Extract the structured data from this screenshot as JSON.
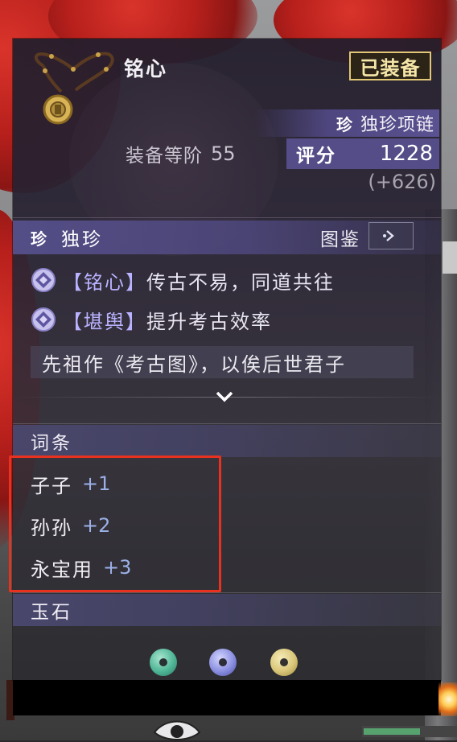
{
  "item": {
    "name": "铭心",
    "equipped_badge": "已装备",
    "rarity_glyph": "珍",
    "rarity_type": "独珍项链",
    "tier_label": "装备等阶",
    "tier_value": "55",
    "score_label": "评分",
    "score_value": "1228",
    "score_delta": "(+626)"
  },
  "rarity_section": {
    "glyph": "珍",
    "title": "独珍",
    "atlas_label": "图鉴",
    "atlas_icon": "arrow-right-icon",
    "effects": [
      {
        "open": "【",
        "name": "铭心",
        "close": "】",
        "desc": "传古不易，同道共往"
      },
      {
        "open": "【",
        "name": "堪舆",
        "close": "】",
        "desc": "提升考古效率"
      }
    ],
    "flavor": "先祖作《考古图》，以俟后世君子"
  },
  "affix_section": {
    "title": "词条",
    "items": [
      {
        "name": "子子",
        "bonus": "+1"
      },
      {
        "name": "孙孙",
        "bonus": "+2"
      },
      {
        "name": "永宝用",
        "bonus": "+3"
      }
    ]
  },
  "jade_section": {
    "title": "玉石",
    "slots": [
      {
        "icon": "green-jade-icon",
        "color": "#4fb596"
      },
      {
        "icon": "blue-jade-icon",
        "color": "#8b8fe0"
      },
      {
        "icon": "yellow-jade-icon",
        "color": "#d9c679"
      }
    ]
  },
  "colors": {
    "highlight_border": "#e8321f",
    "badge_gold": "#e2c776",
    "rarity_purple": "#58508e"
  }
}
